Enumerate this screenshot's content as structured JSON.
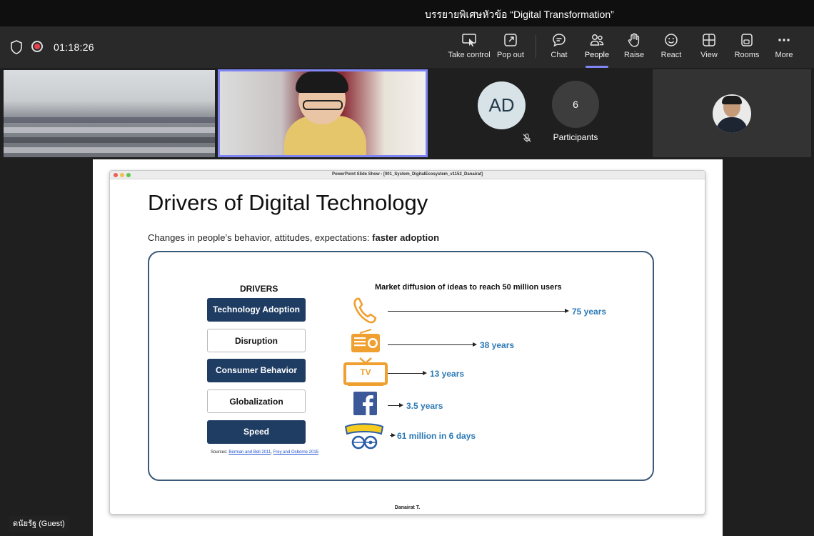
{
  "window": {
    "title": "บรรยายพิเศษหัวข้อ “Digital Transformation”"
  },
  "meeting": {
    "timer": "01:18:26"
  },
  "toolbar": {
    "take_control": "Take control",
    "pop_out": "Pop out",
    "chat": "Chat",
    "people": "People",
    "raise": "Raise",
    "react": "React",
    "view": "View",
    "rooms": "Rooms",
    "more": "More",
    "active": "people"
  },
  "participants": {
    "initials": "AD",
    "count": "6",
    "label": "Participants"
  },
  "slide": {
    "app_title": "PowerPoint Slide Show - [001_System_DigitalEcosystem_v1152_Danairat]",
    "heading": "Drivers of Digital Technology",
    "subtitle_prefix": "Changes in people’s behavior, attitudes, expectations: ",
    "subtitle_bold": "faster adoption",
    "drivers_heading": "DRIVERS",
    "drivers": [
      "Technology Adoption",
      "Disruption",
      "Consumer Behavior",
      "Globalization",
      "Speed"
    ],
    "sources_prefix": "Sources: ",
    "source_1": "Berman and Bell 2011",
    "source_sep": ", ",
    "source_2": "Frey and Osborne 2015",
    "market_heading": "Market diffusion of ideas to reach 50 million users",
    "tv_label": "TV",
    "diffusion": [
      "75 years",
      "38 years",
      "13 years",
      "3.5 years",
      "61 million in 6 days"
    ],
    "footer": "Danairat T."
  },
  "guest": {
    "name": "ดนัยรัฐ (Guest)"
  },
  "colors": {
    "accent": "#7f85f5",
    "record": "#e8414d",
    "driver_dark": "#1f3d63",
    "value_blue": "#2d7ab6",
    "icon_orange": "#f0a030",
    "facebook": "#3b5998"
  }
}
